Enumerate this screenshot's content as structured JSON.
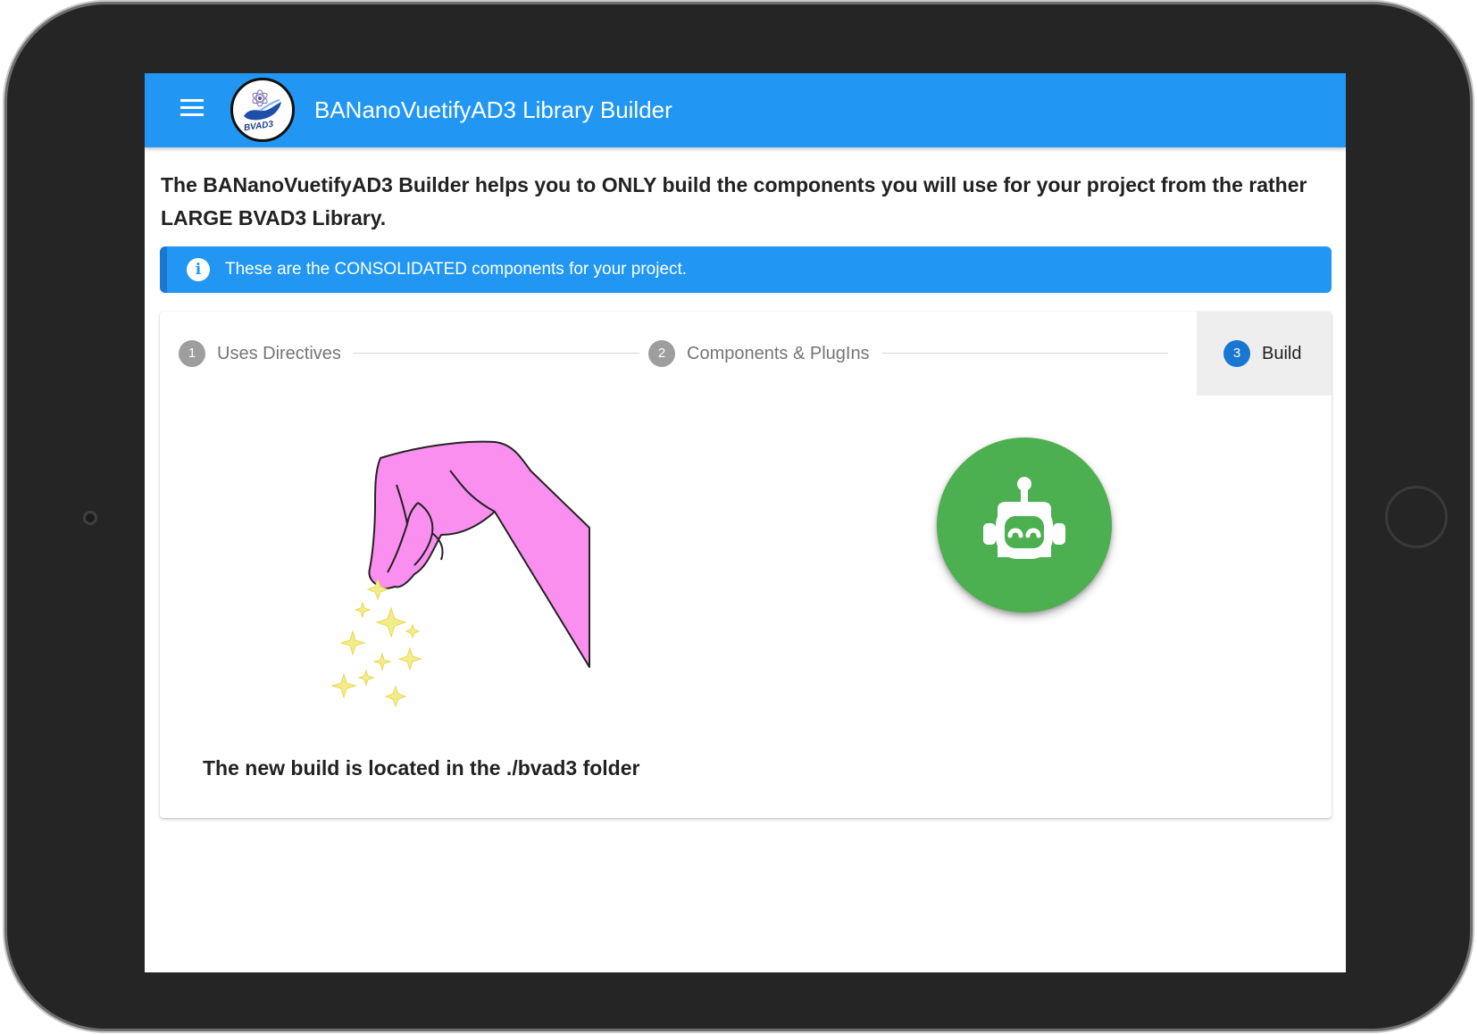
{
  "app_bar": {
    "title": "BANanoVuetifyAD3 Library Builder",
    "logo_text": "BVAD3",
    "color": "#2196f3"
  },
  "intro_text": "The BANanoVuetifyAD3 Builder helps you to ONLY build the components you will use for your project from the rather LARGE BVAD3 Library.",
  "alert": {
    "icon": "info-icon",
    "icon_glyph": "i",
    "text": "These are the CONSOLIDATED components for your project.",
    "color": "#2196f3"
  },
  "stepper": {
    "steps": [
      {
        "number": "1",
        "label": "Uses Directives",
        "active": false
      },
      {
        "number": "2",
        "label": "Components & PlugIns",
        "active": false
      },
      {
        "number": "3",
        "label": "Build",
        "active": true
      }
    ],
    "active_color": "#1976d2"
  },
  "build": {
    "illustration": "hand-sprinkling-magic-dust",
    "action_icon": "robot-icon",
    "action_color": "#4caf50",
    "message": "The new build is located in the ./bvad3 folder"
  }
}
